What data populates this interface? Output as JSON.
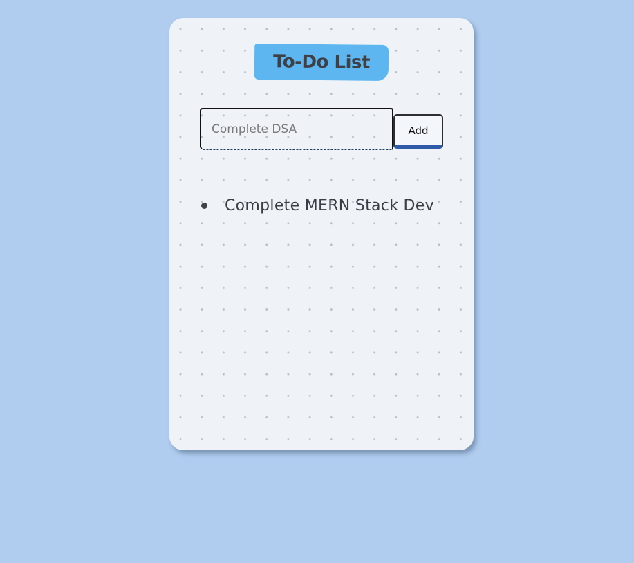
{
  "app": {
    "title": "To-Do List"
  },
  "form": {
    "input_placeholder": "Complete DSA",
    "input_value": "",
    "add_label": "Add"
  },
  "tasks": [
    {
      "text": "Complete MERN Stack Dev"
    }
  ],
  "colors": {
    "page_background": "#b0cdf0",
    "card_background": "#eff3f7",
    "title_highlight": "#5db6f0",
    "button_accent": "#2e5aa8",
    "text": "#3a3f46"
  }
}
